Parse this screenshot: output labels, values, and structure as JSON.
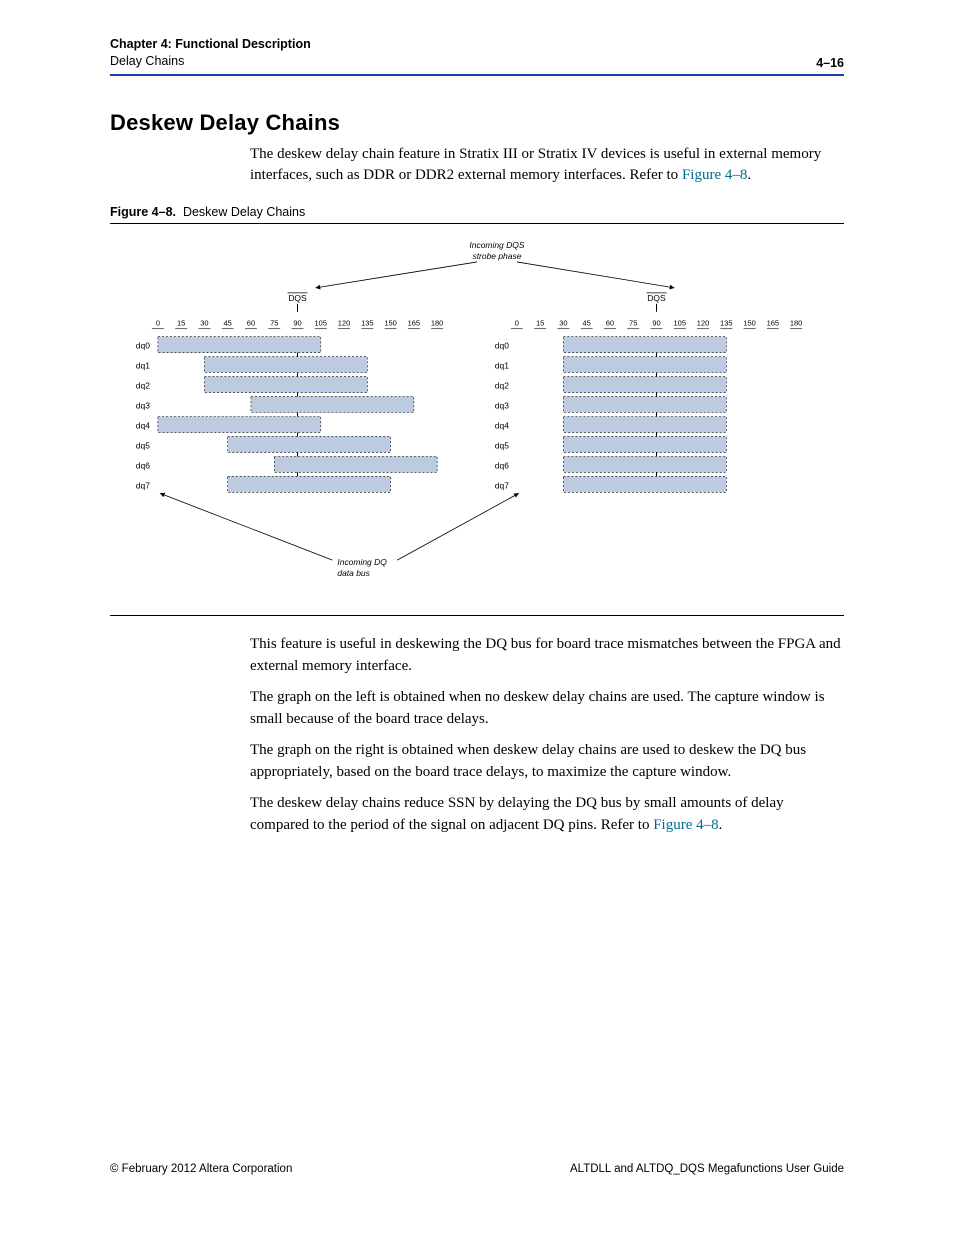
{
  "header": {
    "chapter": "Chapter 4:  Functional Description",
    "sub": "Delay Chains",
    "page": "4–16"
  },
  "section_title": "Deskew Delay Chains",
  "para_intro": "The deskew delay chain feature in Stratix III or Stratix IV devices is useful in external memory interfaces, such as DDR or DDR2 external memory interfaces. Refer to ",
  "fig_ref_1": "Figure 4–8",
  "figure": {
    "caption_prefix": "Figure 4–8.",
    "caption_text": "Deskew Delay Chains",
    "top_label": "Incoming DQS strobe phase",
    "bottom_label": "Incoming DQ data bus",
    "dqs_label": "DQS",
    "axis_ticks": [
      "0",
      "15",
      "30",
      "45",
      "60",
      "75",
      "90",
      "105",
      "120",
      "135",
      "150",
      "165",
      "180"
    ],
    "dq_labels": [
      "dq0",
      "dq1",
      "dq2",
      "dq3",
      "dq4",
      "dq5",
      "dq6",
      "dq7"
    ],
    "left_chart": {
      "dqs_phase": 90,
      "bars": [
        {
          "start": 0,
          "end": 105
        },
        {
          "start": 30,
          "end": 135
        },
        {
          "start": 30,
          "end": 135
        },
        {
          "start": 60,
          "end": 165
        },
        {
          "start": 0,
          "end": 105
        },
        {
          "start": 45,
          "end": 150
        },
        {
          "start": 75,
          "end": 180
        },
        {
          "start": 45,
          "end": 150
        }
      ]
    },
    "right_chart": {
      "dqs_phase": 90,
      "bars": [
        {
          "start": 30,
          "end": 135
        },
        {
          "start": 30,
          "end": 135
        },
        {
          "start": 30,
          "end": 135
        },
        {
          "start": 30,
          "end": 135
        },
        {
          "start": 30,
          "end": 135
        },
        {
          "start": 30,
          "end": 135
        },
        {
          "start": 30,
          "end": 135
        },
        {
          "start": 30,
          "end": 135
        }
      ]
    }
  },
  "para_after_1": "This feature is useful in deskewing the DQ bus for board trace mismatches between the FPGA and external memory interface.",
  "para_after_2": "The graph on the left is obtained when no deskew delay chains are used. The capture window is small because of the board trace delays.",
  "para_after_3": "The graph on the right is obtained when deskew delay chains are used to deskew the DQ bus appropriately, based on the board trace delays, to maximize the capture window.",
  "para_after_4a": "The deskew delay chains reduce SSN by delaying the DQ bus by small amounts of delay compared to the period of the signal on adjacent DQ pins. Refer to ",
  "fig_ref_2": "Figure 4–8",
  "footer": {
    "left": "© February 2012   Altera Corporation",
    "right": "ALTDLL and ALTDQ_DQS Megafunctions User Guide"
  }
}
